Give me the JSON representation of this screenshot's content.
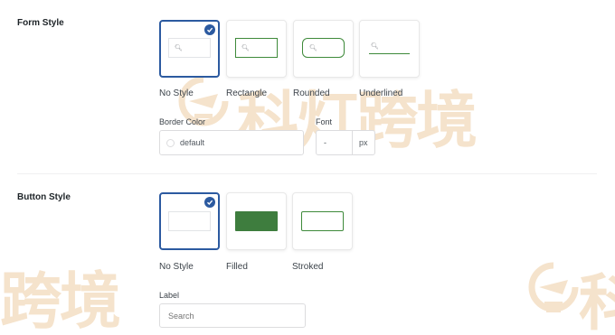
{
  "form_style": {
    "title": "Form Style",
    "options": [
      {
        "label": "No Style",
        "selected": true
      },
      {
        "label": "Rectangle",
        "selected": false
      },
      {
        "label": "Rounded",
        "selected": false
      },
      {
        "label": "Underlined",
        "selected": false
      }
    ],
    "border_color": {
      "label": "Border Color",
      "value": "default"
    },
    "font": {
      "label": "Font",
      "value": "-",
      "unit": "px"
    }
  },
  "button_style": {
    "title": "Button Style",
    "options": [
      {
        "label": "No Style",
        "selected": true
      },
      {
        "label": "Filled",
        "selected": false
      },
      {
        "label": "Stroked",
        "selected": false
      }
    ],
    "label_field": {
      "label": "Label",
      "placeholder": "Search"
    }
  },
  "watermark": {
    "text_main": "科灯跨境",
    "text_lower": "跨境",
    "text_right": "科"
  },
  "colors": {
    "accent": "#2c5aa0",
    "green": "#3e8a3a",
    "watermark": "#f5e3cc"
  }
}
